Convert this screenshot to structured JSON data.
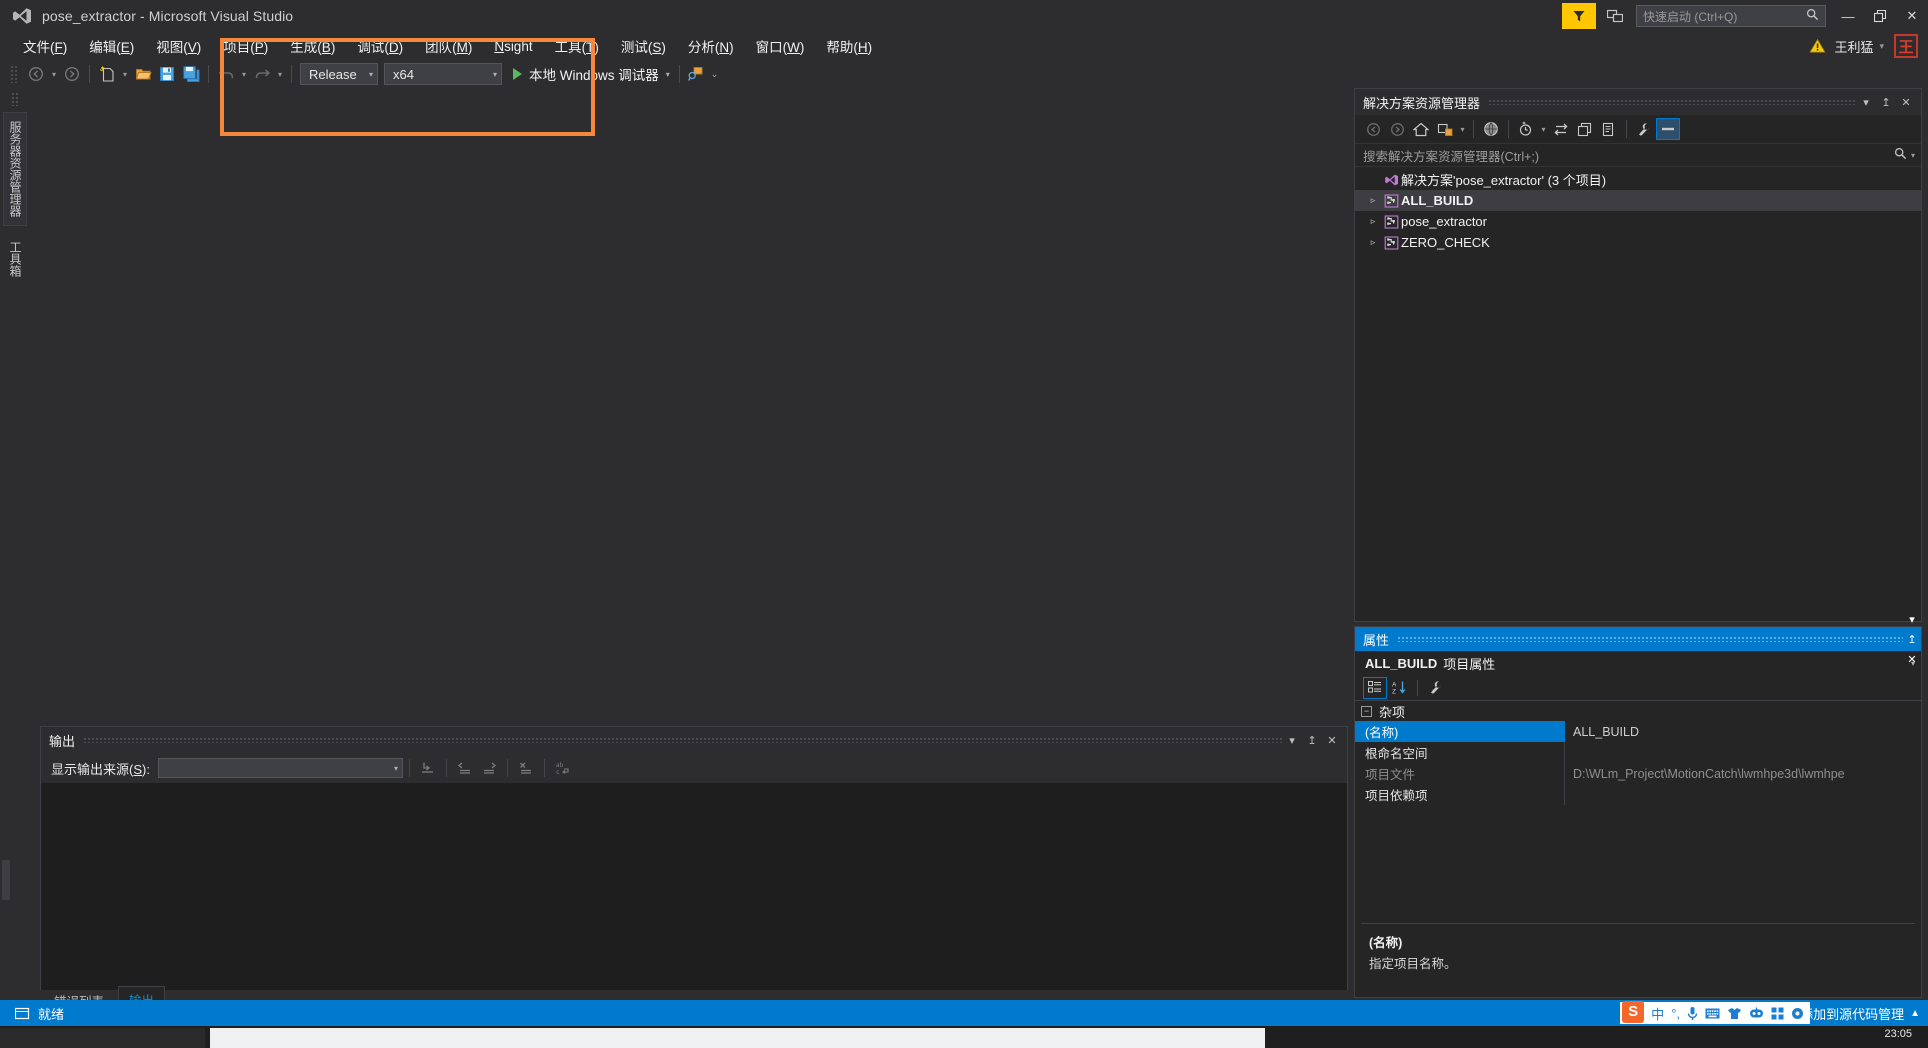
{
  "window": {
    "title": "pose_extractor - Microsoft Visual Studio",
    "logo_icon": "visual-studio-logo-icon",
    "minimize": "—",
    "maximize": "❐",
    "close": "✕",
    "feedback_icon": "feedback-funnel-icon",
    "screen_share_icon": "screen-share-icon"
  },
  "quick_launch": {
    "placeholder": "快速启动 (Ctrl+Q)",
    "search_icon": "search-icon"
  },
  "account": {
    "warning_icon": "warning-triangle-icon",
    "user_name": "王利猛",
    "caret": "▾",
    "avatar_initial": "王"
  },
  "menubar": {
    "items": [
      {
        "label": "文件",
        "accel": "F"
      },
      {
        "label": "编辑",
        "accel": "E"
      },
      {
        "label": "视图",
        "accel": "V"
      },
      {
        "label": "项目",
        "accel": "P"
      },
      {
        "label": "生成",
        "accel": "B"
      },
      {
        "label": "调试",
        "accel": "D"
      },
      {
        "label": "团队",
        "accel": "M"
      },
      {
        "label": "Nsight",
        "accel": "N"
      },
      {
        "label": "工具",
        "accel": "T"
      },
      {
        "label": "测试",
        "accel": "S"
      },
      {
        "label": "分析",
        "accel": "N"
      },
      {
        "label": "窗口",
        "accel": "W"
      },
      {
        "label": "帮助",
        "accel": "H"
      }
    ]
  },
  "toolbar": {
    "nav_back_icon": "navigate-back-icon",
    "nav_forward_icon": "navigate-forward-icon",
    "new_item_icon": "new-item-icon",
    "open_file_icon": "open-file-icon",
    "save_icon": "save-icon",
    "save_all_icon": "save-all-icon",
    "undo_icon": "undo-icon",
    "redo_icon": "redo-icon",
    "configuration": "Release",
    "platform": "x64",
    "run_label": "本地 Windows 调试器",
    "run_icon": "play-triangle-icon",
    "attach_icon": "attach-to-process-icon",
    "overflow_icon": "toolbar-overflow-icon",
    "caret": "▾"
  },
  "annotation": {
    "color": "#f7873a",
    "shape": "rectangle-highlight"
  },
  "left_rail": {
    "tabs": [
      {
        "label": "服务器资源管理器"
      },
      {
        "label": "工具箱"
      }
    ]
  },
  "solution_explorer": {
    "title": "解决方案资源管理器",
    "header_buttons": {
      "dropdown": "▾",
      "pin": "↥",
      "close": "✕"
    },
    "toolbar_icons": [
      "back-icon",
      "forward-icon",
      "home-icon",
      "pending-changes-icon",
      "show-all-files-icon",
      "sync-with-active-document-icon",
      "refresh-icon",
      "collapse-all-icon",
      "properties-window-icon",
      "preview-selected-items-icon",
      "solution-explorer-settings-icon"
    ],
    "search_placeholder": "搜索解决方案资源管理器(Ctrl+;)",
    "search_icon": "search-icon",
    "tree": [
      {
        "label": "解决方案'pose_extractor' (3 个项目)",
        "icon": "solution-icon",
        "arrow": "",
        "selected": false,
        "indent": 0
      },
      {
        "label": "ALL_BUILD",
        "icon": "project-icon",
        "arrow": "▹",
        "selected": true,
        "indent": 1
      },
      {
        "label": "pose_extractor",
        "icon": "project-icon",
        "arrow": "▹",
        "selected": false,
        "indent": 1
      },
      {
        "label": "ZERO_CHECK",
        "icon": "project-icon",
        "arrow": "▹",
        "selected": false,
        "indent": 1
      }
    ]
  },
  "properties": {
    "title": "属性",
    "header_buttons": {
      "dropdown": "▾",
      "pin": "↥",
      "close": "✕"
    },
    "subject_bold": "ALL_BUILD",
    "subject_rest": "项目属性",
    "subject_caret": "▾",
    "toolbar_icons": [
      "categorized-view-icon",
      "alphabetical-sort-icon",
      "property-pages-icon"
    ],
    "group_label": "杂项",
    "group_expander": "−",
    "rows": [
      {
        "name": "(名称)",
        "value": "ALL_BUILD",
        "selected": true,
        "dim": false
      },
      {
        "name": "根命名空间",
        "value": "",
        "selected": false,
        "dim": false
      },
      {
        "name": "项目文件",
        "value": "D:\\WLm_Project\\MotionCatch\\lwmhpe3d\\lwmhpe",
        "selected": false,
        "dim": true
      },
      {
        "name": "项目依赖项",
        "value": "",
        "selected": false,
        "dim": false
      }
    ],
    "description_title": "(名称)",
    "description_body": "指定项目名称。"
  },
  "output_panel": {
    "title": "输出",
    "header_buttons": {
      "dropdown": "▾",
      "pin": "↥",
      "close": "✕"
    },
    "source_label": "显示输出来源",
    "source_accel": "S",
    "source_value": "",
    "toolbar_icons": [
      "go-to-message-icon",
      "find-previous-message-icon",
      "find-next-message-icon",
      "clear-all-icon",
      "toggle-word-wrap-icon"
    ],
    "body_text": ""
  },
  "panel_tabs": {
    "items": [
      {
        "label": "错误列表",
        "active": false
      },
      {
        "label": "输出",
        "active": true
      }
    ]
  },
  "statusbar": {
    "ready_icon": "ready-status-icon",
    "ready_text": "就绪",
    "source_control_text": "添加到源代码管理",
    "source_control_caret": "▲"
  },
  "ime_bar": {
    "logo": "S",
    "items": [
      {
        "glyph": "中",
        "name": "chinese-mode-icon"
      },
      {
        "glyph": "°,",
        "name": "punctuation-mode-icon"
      },
      {
        "glyph": "🎙",
        "name": "voice-input-icon"
      },
      {
        "glyph": "⌨",
        "name": "soft-keyboard-icon"
      },
      {
        "glyph": "👕",
        "name": "skin-theme-icon"
      },
      {
        "glyph": "🤖",
        "name": "ai-assistant-icon"
      },
      {
        "glyph": "⊞",
        "name": "toolbox-icon"
      },
      {
        "glyph": "⚙",
        "name": "settings-icon"
      }
    ]
  },
  "taskbar": {
    "clock": "23:05"
  }
}
